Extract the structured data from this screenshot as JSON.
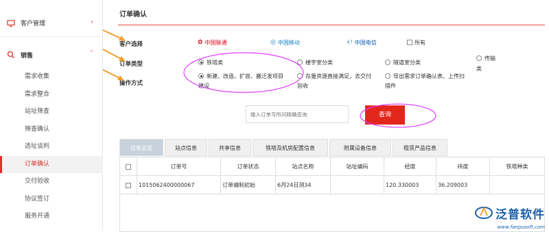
{
  "sidebar": {
    "group1": {
      "label": "客户管理",
      "chevron": "›"
    },
    "group2": {
      "label": "销售",
      "chevron": "˅"
    },
    "items": [
      {
        "label": "需求收集"
      },
      {
        "label": "需求整合"
      },
      {
        "label": "站址筛查"
      },
      {
        "label": "筛查确认"
      },
      {
        "label": "选址谈判"
      },
      {
        "label": "订单确认"
      },
      {
        "label": "交付验收"
      },
      {
        "label": "协议签订"
      },
      {
        "label": "服务开通"
      }
    ],
    "active_index": 5
  },
  "page": {
    "title": "订单确认"
  },
  "filters": {
    "customer": {
      "label": "客户选择",
      "options": [
        {
          "label": "中国联通",
          "icon": "unicom-logo-icon"
        },
        {
          "label": "中国移动",
          "icon": "mobile-logo-icon"
        },
        {
          "label": "中国电信",
          "icon": "telecom-logo-icon"
        }
      ],
      "all_label": "所有"
    },
    "order_type": {
      "label": "订单类型",
      "options": [
        {
          "label": "铁塔类",
          "selected": true
        },
        {
          "label": "楼宇室分类",
          "selected": false
        },
        {
          "label": "隧道室分类",
          "selected": false
        },
        {
          "label": "传输",
          "line2": "类",
          "selected": false
        }
      ]
    },
    "operation": {
      "label": "操作方式",
      "options": [
        {
          "label": "新建、改造、扩容、搬迁发项目",
          "line2": "建设",
          "selected": true
        },
        {
          "label": "存量资源直接满足，去交付",
          "line2": "验收",
          "selected": false
        },
        {
          "label": "导出需求订单确认表、上传扫",
          "line2": "描件",
          "selected": false
        }
      ]
    }
  },
  "search": {
    "placeholder": "输入订单号所问精确查询",
    "button_label": "查询"
  },
  "tabs": [
    {
      "label": "信息总览",
      "active": true
    },
    {
      "label": "站点信息",
      "active": false
    },
    {
      "label": "共享信息",
      "active": false
    },
    {
      "label": "铁塔及机房配置信息",
      "active": false
    },
    {
      "label": "附属设备信息",
      "active": false
    },
    {
      "label": "租赁产品信息",
      "active": false
    }
  ],
  "table": {
    "headers": [
      "订单号",
      "订单状态",
      "站点名称",
      "站址编码",
      "经度",
      "纬度",
      "铁塔种类"
    ],
    "rows": [
      [
        "1015062400000067",
        "订单编制初始",
        "6月24日测34",
        "",
        "120.330003",
        "36.209003",
        ""
      ]
    ]
  },
  "brand": {
    "name": "泛普软件",
    "url": "www.fanpusoft.com"
  },
  "colors": {
    "accent": "#e2261c",
    "annotation": "#e040fb",
    "arrow": "#f0a030",
    "brand": "#1a5fa8"
  }
}
